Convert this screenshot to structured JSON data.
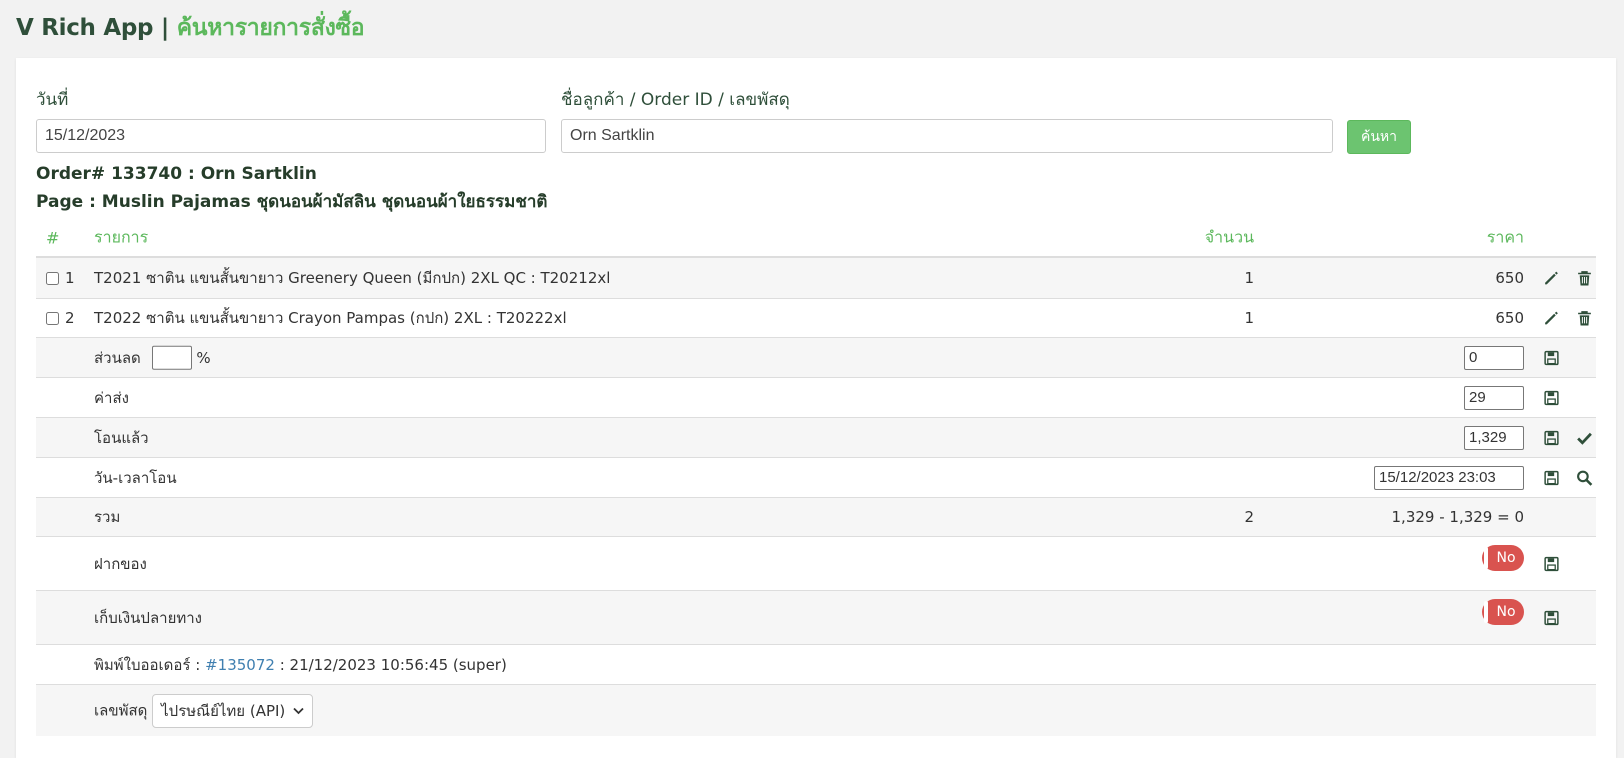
{
  "header": {
    "app": "V Rich App",
    "separator": "|",
    "subtitle": "ค้นหารายการสั่งซื้อ"
  },
  "search": {
    "date_label": "วันที่",
    "date_value": "15/12/2023",
    "query_label": "ชื่อลูกค้า / Order ID / เลขพัสดุ",
    "query_value": "Orn Sartklin",
    "button": "ค้นหา"
  },
  "order": {
    "title": "Order# 133740 : Orn Sartklin",
    "page": "Page : Muslin Pajamas ชุดนอนผ้ามัสลิน ชุดนอนผ้าใยธรรมชาติ"
  },
  "table": {
    "headers": {
      "num": "#",
      "item": "รายการ",
      "qty": "จำนวน",
      "price": "ราคา"
    },
    "items": [
      {
        "num": "1",
        "name": "T2021 ซาติน แขนสั้นขายาว Greenery Queen (มีกปก) 2XL QC : T20212xl",
        "qty": "1",
        "price": "650"
      },
      {
        "num": "2",
        "name": "T2022 ซาติน แขนสั้นขายาว Crayon Pampas (กปก) 2XL : T20222xl",
        "qty": "1",
        "price": "650"
      }
    ],
    "discount_label": "ส่วนลด",
    "discount_percent": "",
    "percent_sign": "%",
    "discount_value": "0",
    "shipping_label": "ค่าส่ง",
    "shipping_value": "29",
    "transferred_label": "โอนแล้ว",
    "transferred_value": "1,329",
    "transfer_time_label": "วัน-เวลาโอน",
    "transfer_time_value": "15/12/2023 23:03",
    "total_label": "รวม",
    "total_qty": "2",
    "total_value": "1,329 - 1,329 = 0",
    "deposit_label": "ฝากของ",
    "deposit_toggle": "No",
    "cod_label": "เก็บเงินปลายทาง",
    "cod_toggle": "No",
    "print_label": "พิมพ์ใบออเดอร์ :",
    "print_link": "#135072",
    "print_info": ": 21/12/2023 10:56:45 (super)",
    "tracking_label": "เลขพัสดุ",
    "tracking_select": "ไปรษณีย์ไทย (API)"
  },
  "colors": {
    "accent": "#5cb85c",
    "danger": "#d9534f",
    "icon": "#2f4f3a"
  }
}
